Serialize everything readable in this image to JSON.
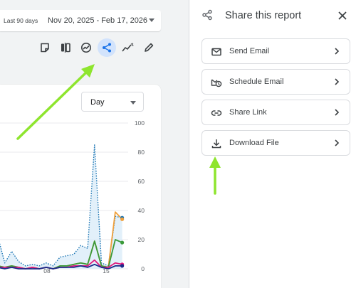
{
  "daterange": {
    "preset": "Last 90 days",
    "range": "Nov 20, 2025 - Feb 17, 2026"
  },
  "toolbar": {
    "icons": [
      "note-icon",
      "compare-icon",
      "insights-icon",
      "share-icon",
      "trend-icon",
      "edit-icon"
    ],
    "active": "share-icon"
  },
  "chart": {
    "granularity": "Day",
    "y_ticks": [
      "100",
      "80",
      "60",
      "40",
      "20",
      "0"
    ],
    "x_ticks": [
      "08",
      "15"
    ]
  },
  "share_panel": {
    "title": "Share this report",
    "options": [
      {
        "label": "Send Email",
        "icon": "mail-icon"
      },
      {
        "label": "Schedule Email",
        "icon": "schedule-email-icon"
      },
      {
        "label": "Share Link",
        "icon": "link-icon"
      },
      {
        "label": "Download File",
        "icon": "download-icon"
      }
    ]
  },
  "colors": {
    "accent": "#1a73e8",
    "annotation_arrow": "#8ee52e",
    "series_dotted": "#1f77b4",
    "series_orange": "#f0a03c",
    "series_green": "#3a9a3a",
    "series_magenta": "#e0197d",
    "series_navy": "#1a2a8a"
  },
  "chart_data": {
    "type": "line",
    "x_tick_labels": [
      "08",
      "15"
    ],
    "ylim": [
      0,
      100
    ],
    "y_ticks": [
      0,
      20,
      40,
      60,
      80,
      100
    ],
    "grid": true,
    "series": [
      {
        "style": "dotted",
        "color": "#1f77b4",
        "values": [
          22,
          4,
          12,
          5,
          2,
          3,
          2,
          4,
          2,
          8,
          9,
          10,
          16,
          14,
          85,
          4,
          2,
          36,
          35
        ]
      },
      {
        "style": "solid",
        "color": "#f0a03c",
        "values": [
          2,
          1,
          2,
          1,
          0,
          1,
          0,
          1,
          0,
          2,
          2,
          3,
          4,
          3,
          19,
          2,
          1,
          39,
          34
        ]
      },
      {
        "style": "solid",
        "color": "#3a9a3a",
        "values": [
          2,
          1,
          2,
          1,
          0,
          1,
          0,
          1,
          0,
          2,
          2,
          3,
          4,
          3,
          19,
          2,
          1,
          20,
          18
        ]
      },
      {
        "style": "solid",
        "color": "#e0197d",
        "values": [
          1,
          1,
          1,
          1,
          0,
          1,
          0,
          1,
          0,
          1,
          1,
          2,
          2,
          2,
          6,
          1,
          1,
          4,
          3
        ]
      },
      {
        "style": "solid",
        "color": "#1a2a8a",
        "values": [
          1,
          0,
          1,
          0,
          0,
          0,
          0,
          1,
          0,
          1,
          1,
          1,
          2,
          1,
          3,
          1,
          0,
          2,
          2
        ]
      }
    ]
  }
}
